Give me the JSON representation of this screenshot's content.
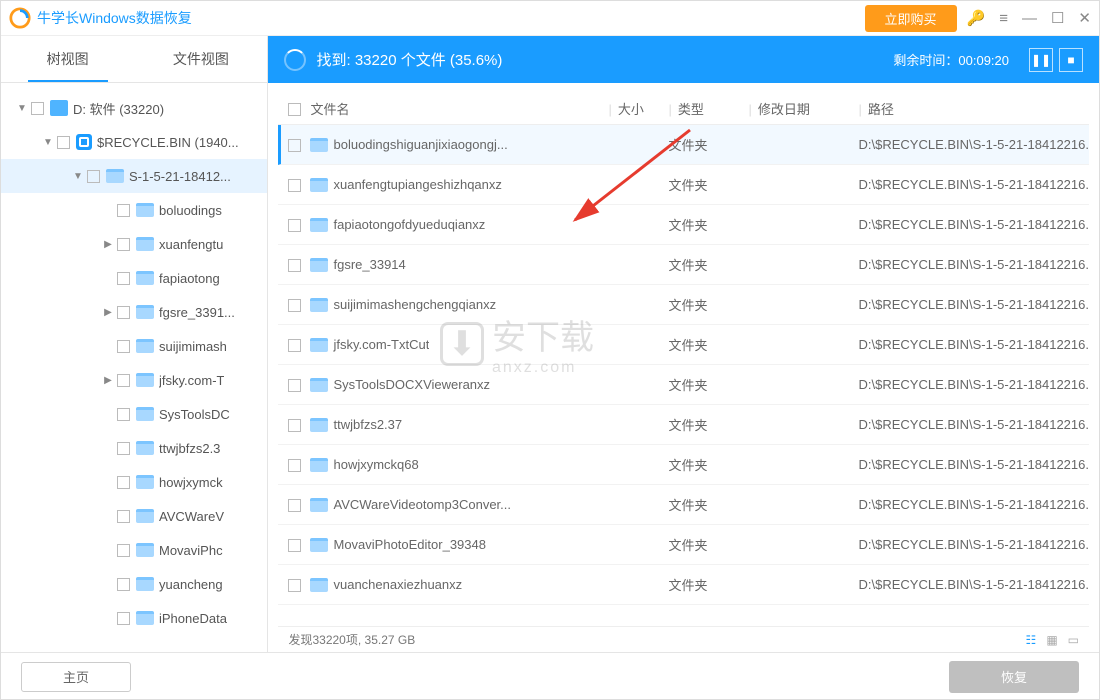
{
  "title": "牛学长Windows数据恢复",
  "buy_label": "立即购买",
  "tabs": {
    "tree": "树视图",
    "file": "文件视图"
  },
  "tree": {
    "drive": "D: 软件  (33220)",
    "recycle": "$RECYCLE.BIN  (1940...",
    "sid": "S-1-5-21-18412...",
    "items": [
      "boluodings",
      "xuanfengtu",
      "fapiaotong",
      "fgsre_3391...",
      "suijimimash",
      "jfsky.com-T",
      "SysToolsDC",
      "ttwjbfzs2.3",
      "howjxymck",
      "AVCWareV",
      "MovaviPhc",
      "yuancheng",
      "iPhoneData"
    ],
    "expandable": [
      false,
      true,
      false,
      true,
      false,
      true,
      false,
      false,
      false,
      false,
      false,
      false,
      false
    ]
  },
  "scan": {
    "found_label": "找到: 33220 个文件 (35.6%)",
    "remain_label": "剩余时间：00:09:20"
  },
  "columns": {
    "name": "文件名",
    "size": "大小",
    "type": "类型",
    "date": "修改日期",
    "path": "路径"
  },
  "rows": [
    {
      "name": "boluodingshiguanjixiaogongj...",
      "type": "文件夹",
      "path": "D:\\$RECYCLE.BIN\\S-1-5-21-18412216.",
      "sel": true
    },
    {
      "name": "xuanfengtupiangeshizhqanxz",
      "type": "文件夹",
      "path": "D:\\$RECYCLE.BIN\\S-1-5-21-18412216."
    },
    {
      "name": "fapiaotongofdyueduqianxz",
      "type": "文件夹",
      "path": "D:\\$RECYCLE.BIN\\S-1-5-21-18412216."
    },
    {
      "name": "fgsre_33914",
      "type": "文件夹",
      "path": "D:\\$RECYCLE.BIN\\S-1-5-21-18412216."
    },
    {
      "name": "suijimimashengchengqianxz",
      "type": "文件夹",
      "path": "D:\\$RECYCLE.BIN\\S-1-5-21-18412216."
    },
    {
      "name": "jfsky.com-TxtCut",
      "type": "文件夹",
      "path": "D:\\$RECYCLE.BIN\\S-1-5-21-18412216."
    },
    {
      "name": "SysToolsDOCXVieweranxz",
      "type": "文件夹",
      "path": "D:\\$RECYCLE.BIN\\S-1-5-21-18412216."
    },
    {
      "name": "ttwjbfzs2.37",
      "type": "文件夹",
      "path": "D:\\$RECYCLE.BIN\\S-1-5-21-18412216."
    },
    {
      "name": "howjxymckq68",
      "type": "文件夹",
      "path": "D:\\$RECYCLE.BIN\\S-1-5-21-18412216."
    },
    {
      "name": "AVCWareVideotomp3Conver...",
      "type": "文件夹",
      "path": "D:\\$RECYCLE.BIN\\S-1-5-21-18412216."
    },
    {
      "name": "MovaviPhotoEditor_39348",
      "type": "文件夹",
      "path": "D:\\$RECYCLE.BIN\\S-1-5-21-18412216."
    },
    {
      "name": "vuanchenaxiezhuanxz",
      "type": "文件夹",
      "path": "D:\\$RECYCLE.BIN\\S-1-5-21-18412216."
    }
  ],
  "status": "发现33220项, 35.27 GB",
  "footer": {
    "home": "主页",
    "recover": "恢复"
  },
  "watermark": {
    "main": "安下载",
    "sub": "anxz.com"
  }
}
